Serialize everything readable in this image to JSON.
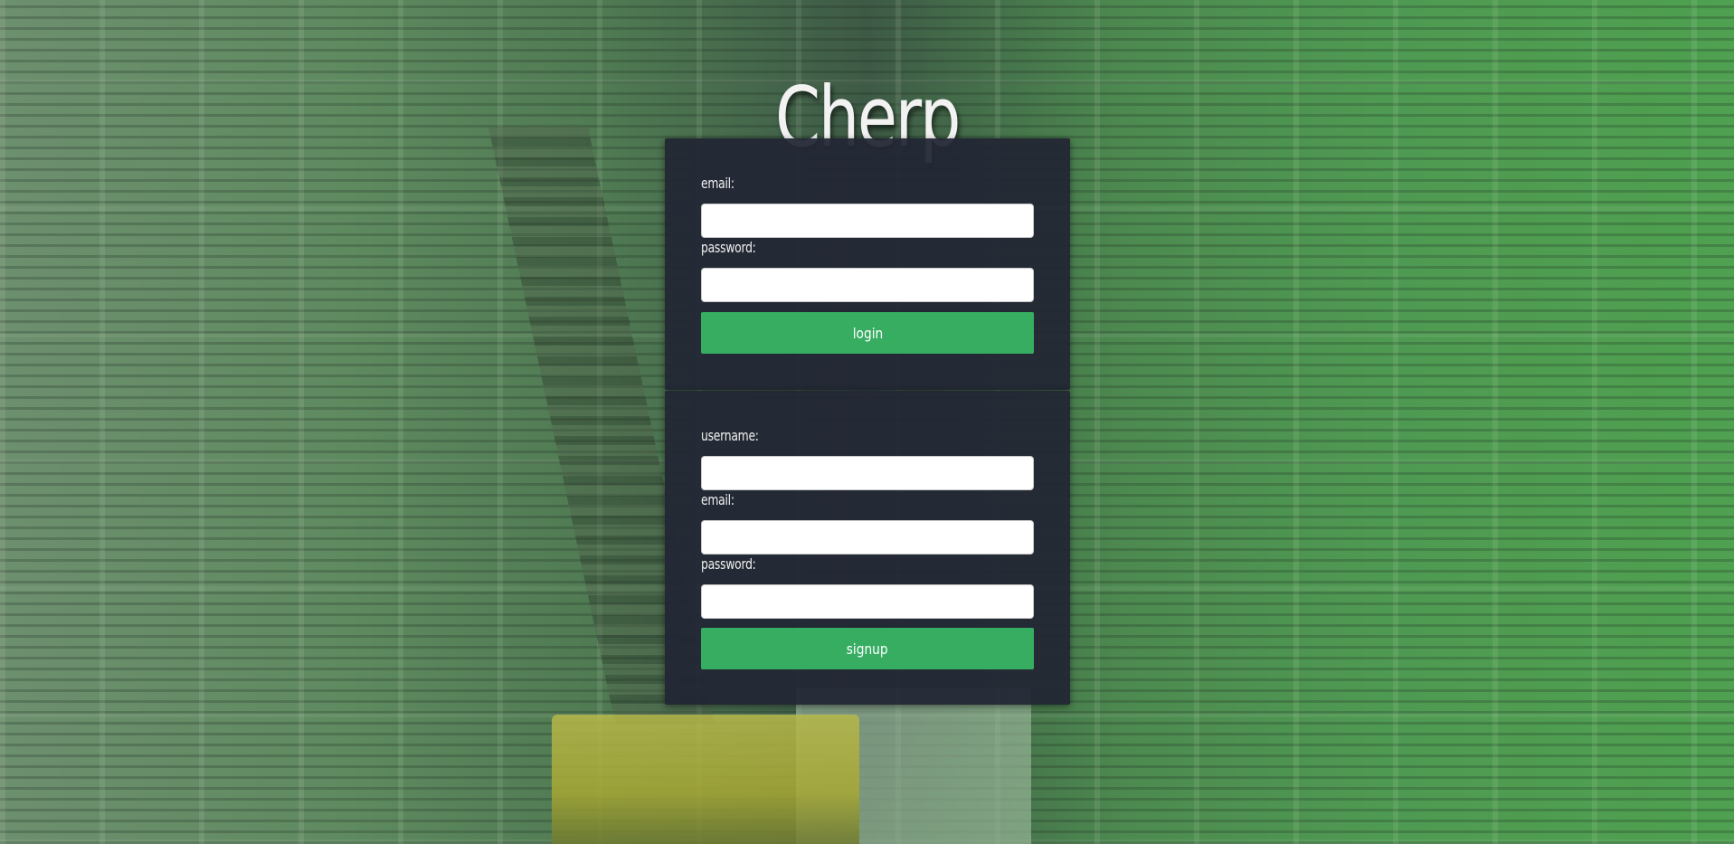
{
  "app": {
    "title": "Cherp"
  },
  "login": {
    "email_label": "email:",
    "email_value": "",
    "password_label": "password:",
    "password_value": "",
    "submit_label": "login"
  },
  "signup": {
    "username_label": "username:",
    "username_value": "",
    "email_label": "email:",
    "email_value": "",
    "password_label": "password:",
    "password_value": "",
    "submit_label": "signup"
  },
  "colors": {
    "accent": "#37ad62",
    "panel": "#22263a",
    "background": "#4f8a52"
  }
}
